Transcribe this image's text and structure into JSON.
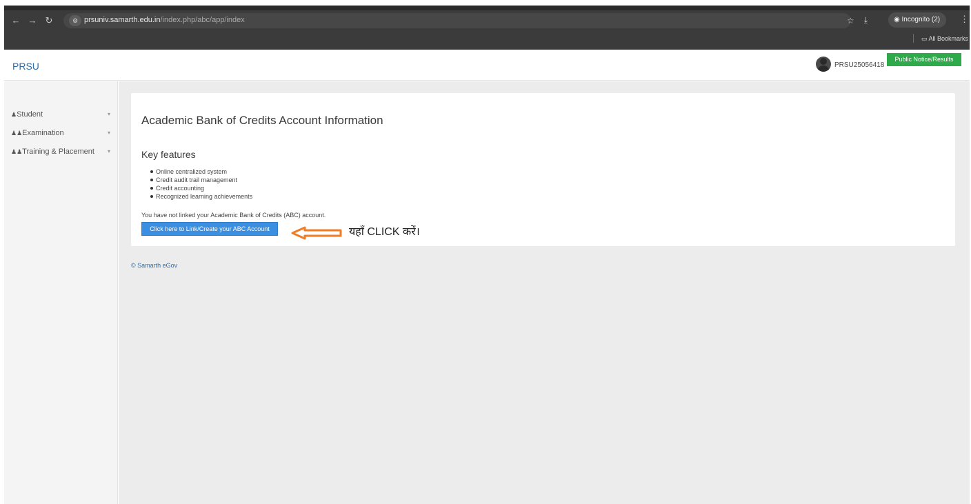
{
  "browser": {
    "url_host": "prsuniv.samarth.edu.in",
    "url_path": "/index.php/abc/app/index",
    "incognito_label": "Incognito (2)",
    "bookmarks_label": "All Bookmarks"
  },
  "header": {
    "brand": "PRSU",
    "user_id": "PRSU25056418",
    "notice_button": "Public Notice/Results"
  },
  "sidebar": {
    "items": [
      {
        "icon": "user-icon",
        "label": "Student"
      },
      {
        "icon": "users-icon",
        "label": "Examination"
      },
      {
        "icon": "users-icon",
        "label": "Training & Placement"
      }
    ]
  },
  "main": {
    "title": "Academic Bank of Credits Account Information",
    "features_heading": "Key features",
    "features": [
      "Online centralized system",
      "Credit audit trail management",
      "Credit accounting",
      "Recognized learning achievements"
    ],
    "notice": "You have not linked your Academic Bank of Credits (ABC) account.",
    "button": "Click here to Link/Create your ABC Account",
    "annotation": "यहाँ CLICK करें।",
    "annotation_color": "#f07c27"
  },
  "footer": {
    "text": "© Samarth eGov"
  }
}
